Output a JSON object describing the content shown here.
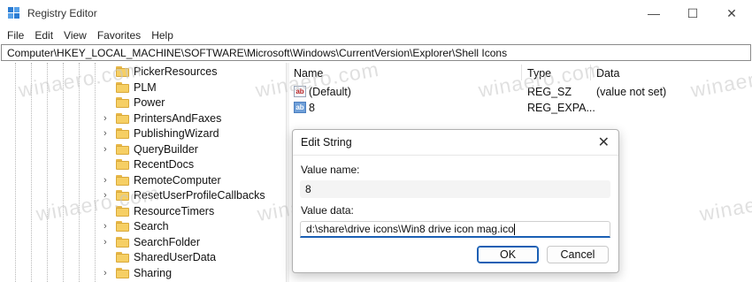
{
  "window": {
    "title": "Registry Editor",
    "controls": [
      "—",
      "☐",
      "✕"
    ]
  },
  "menu": [
    "File",
    "Edit",
    "View",
    "Favorites",
    "Help"
  ],
  "address": "Computer\\HKEY_LOCAL_MACHINE\\SOFTWARE\\Microsoft\\Windows\\CurrentVersion\\Explorer\\Shell Icons",
  "tree": {
    "items": [
      {
        "label": "PickerResources",
        "expandable": false
      },
      {
        "label": "PLM",
        "expandable": false
      },
      {
        "label": "Power",
        "expandable": false
      },
      {
        "label": "PrintersAndFaxes",
        "expandable": true
      },
      {
        "label": "PublishingWizard",
        "expandable": true
      },
      {
        "label": "QueryBuilder",
        "expandable": true
      },
      {
        "label": "RecentDocs",
        "expandable": false
      },
      {
        "label": "RemoteComputer",
        "expandable": true
      },
      {
        "label": "ResetUserProfileCallbacks",
        "expandable": true
      },
      {
        "label": "ResourceTimers",
        "expandable": false
      },
      {
        "label": "Search",
        "expandable": true
      },
      {
        "label": "SearchFolder",
        "expandable": true
      },
      {
        "label": "SharedUserData",
        "expandable": false
      },
      {
        "label": "Sharing",
        "expandable": true
      }
    ]
  },
  "list": {
    "columns": {
      "name": "Name",
      "type": "Type",
      "data": "Data"
    },
    "rows": [
      {
        "name": "(Default)",
        "type": "REG_SZ",
        "data": "(value not set)",
        "icon": "ab"
      },
      {
        "name": "8",
        "type": "REG_EXPA...",
        "data": "",
        "icon": "ab"
      }
    ]
  },
  "dialog": {
    "title": "Edit String",
    "value_name_label": "Value name:",
    "value_name": "8",
    "value_data_label": "Value data:",
    "value_data": "d:\\share\\drive icons\\Win8 drive icon mag.ico",
    "ok_label": "OK",
    "cancel_label": "Cancel",
    "close_glyph": "✕"
  },
  "watermark": "winaero.com",
  "colors": {
    "accent": "#1a5fb4",
    "folder": "#f6cf64"
  }
}
